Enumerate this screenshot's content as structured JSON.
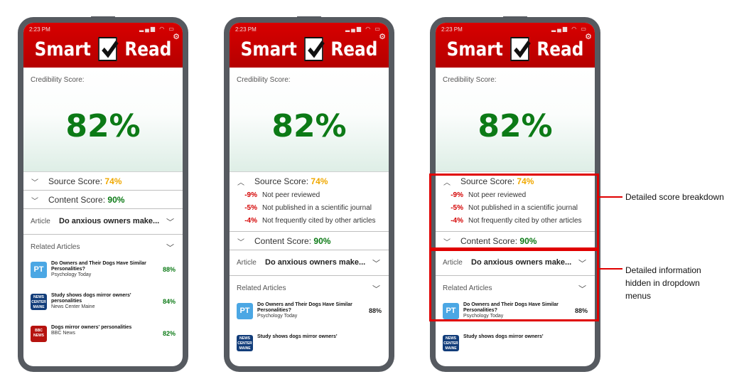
{
  "phones": [
    {
      "status_time": "2:23 PM",
      "logo_left": "Smart",
      "logo_right": "Read",
      "cred_label": "Credibility Score:",
      "cred_value": "82%",
      "source_label": "Source Score:",
      "source_value": "74%",
      "content_label": "Content Score:",
      "content_value": "90%",
      "article_label": "Article",
      "article_title": "Do anxious owners make...",
      "related_label": "Related Articles",
      "related": [
        {
          "icon": "PT",
          "title": "Do Owners and Their Dogs Have Similar Personalities?",
          "source": "Psychology Today",
          "pct": "88%"
        },
        {
          "icon": "NEWS CENTER MAINE",
          "title": "Study shows dogs mirror owners' personalities",
          "source": "News Center Maine",
          "pct": "84%"
        },
        {
          "icon": "BBC NEWS",
          "title": "Dogs mirror owners' personalities",
          "source": "BBC News",
          "pct": "82%"
        }
      ]
    },
    {
      "status_time": "2:23 PM",
      "logo_left": "Smart",
      "logo_right": "Read",
      "cred_label": "Credibility Score:",
      "cred_value": "82%",
      "source_label": "Source Score:",
      "source_value": "74%",
      "breakdown": [
        {
          "pct": "-9%",
          "text": "Not peer reviewed"
        },
        {
          "pct": "-5%",
          "text": "Not published in a scientific journal"
        },
        {
          "pct": "-4%",
          "text": "Not frequently cited by other articles"
        }
      ],
      "content_label": "Content Score:",
      "content_value": "90%",
      "article_label": "Article",
      "article_title": "Do anxious owners make...",
      "related_label": "Related Articles",
      "related": [
        {
          "icon": "PT",
          "title": "Do Owners and Their Dogs Have Similar Personalities?",
          "source": "Psychology Today",
          "pct": "88%"
        },
        {
          "icon": "NEWS CENTER MAINE",
          "title": "Study shows dogs mirror owners'",
          "source": "",
          "pct": ""
        }
      ]
    },
    {
      "status_time": "2:23 PM",
      "logo_left": "Smart",
      "logo_right": "Read",
      "cred_label": "Credibility Score:",
      "cred_value": "82%",
      "source_label": "Source Score:",
      "source_value": "74%",
      "breakdown": [
        {
          "pct": "-9%",
          "text": "Not peer reviewed"
        },
        {
          "pct": "-5%",
          "text": "Not published in a scientific journal"
        },
        {
          "pct": "-4%",
          "text": "Not frequently cited by other articles"
        }
      ],
      "content_label": "Content Score:",
      "content_value": "90%",
      "article_label": "Article",
      "article_title": "Do anxious owners make...",
      "related_label": "Related Articles",
      "related": [
        {
          "icon": "PT",
          "title": "Do Owners and Their Dogs Have Similar Personalities?",
          "source": "Psychology Today",
          "pct": "88%"
        },
        {
          "icon": "NEWS CENTER MAINE",
          "title": "Study shows dogs mirror owners'",
          "source": "",
          "pct": ""
        }
      ]
    }
  ],
  "annotations": {
    "breakdown": "Detailed score breakdown",
    "dropdown": "Detailed information hidden in dropdown menus"
  },
  "colors": {
    "brand_red": "#c00000",
    "score_green": "#0c7a16",
    "score_yellow": "#f0a800",
    "penalty_red": "#d40000",
    "callout_red": "#e00000"
  }
}
